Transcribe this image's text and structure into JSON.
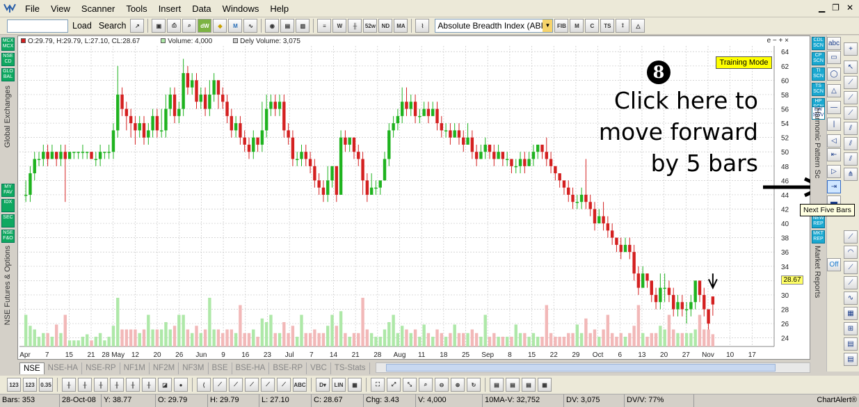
{
  "menubar": {
    "items": [
      "File",
      "View",
      "Scanner",
      "Tools",
      "Insert",
      "Data",
      "Windows",
      "Help"
    ]
  },
  "toolbar": {
    "load_label": "Load",
    "search_label": "Search",
    "indicator_value": "Absolute Breadth Index (ABI"
  },
  "chart": {
    "info": {
      "ohlc": "O:29.79, H:29.79, L:27.10, CL:28.67",
      "volume": "Volume: 4,000",
      "delivery_volume": "Dely Volume: 3,075"
    },
    "controls": "e − + ×",
    "training_mode": "Training Mode",
    "current_price": "28.67"
  },
  "annotation": {
    "step_number": "8",
    "lines": [
      "Click here to",
      "move forward",
      "by 5 bars"
    ]
  },
  "tooltip": "Next Five Bars",
  "left_panel": {
    "top_buttons": [
      "MCX MCX",
      "NSE CD",
      "GLO BAL"
    ],
    "global_label": "Global Exchanges",
    "bottom_buttons": [
      "MY FAV",
      "IDX",
      "SEC",
      "NSE F&O"
    ],
    "futures_label": "NSE Futures & Options"
  },
  "right_panel": {
    "buttons": [
      "CDL SCN",
      "CP SCN",
      "TI SCN",
      "TS SCN",
      "HP SCN",
      "EW SWV"
    ],
    "harmonic_label": "Harmonic Pattern Sc",
    "buttons2": [
      "NEW REP",
      "MKT REP"
    ],
    "reports_label": "Market Reports",
    "off_label": "Off"
  },
  "tabs": [
    "NSE",
    "NSE-HA",
    "NSE-RP",
    "NF1M",
    "NF2M",
    "NF3M",
    "BSE",
    "BSE-HA",
    "BSE-RP",
    "VBC",
    "TS-Stats"
  ],
  "status": {
    "bars": "Bars: 353",
    "date": "28-Oct-08",
    "y": "Y: 38.77",
    "open": "O: 29.79",
    "high": "H: 29.79",
    "low": "L: 27.10",
    "close": "C: 28.67",
    "chg": "Chg: 3.43",
    "volume": "V: 4,000",
    "ma_vol": "10MA-V: 32,752",
    "dv": "DV: 3,075",
    "dvv": "DV/V: 77%",
    "brand": "ChartAlert®"
  },
  "colors": {
    "up_candle": "#1fb31f",
    "down_candle": "#d42020",
    "volume_up": "#aee8a8",
    "volume_down": "#f2b8b8",
    "gridline": "#c8c8c8",
    "training_bg": "#ffff00"
  },
  "chart_data": {
    "type": "candlestick",
    "title": "",
    "x_tick_labels": [
      "Apr",
      "7",
      "15",
      "21",
      "28 May",
      "12",
      "20",
      "26",
      "Jun",
      "9",
      "16",
      "23",
      "Jul",
      "7",
      "14",
      "21",
      "28",
      "Aug",
      "11",
      "18",
      "25",
      "Sep",
      "8",
      "15",
      "22",
      "29",
      "Oct",
      "6",
      "13",
      "20",
      "27",
      "Nov",
      "10",
      "17"
    ],
    "y_ticks": [
      24,
      26,
      28,
      30,
      32,
      34,
      36,
      38,
      40,
      42,
      44,
      46,
      48,
      50,
      52,
      54,
      56,
      58,
      60,
      62,
      64
    ],
    "ylim": [
      22.8,
      64.8
    ],
    "grid": true,
    "candles": [
      {
        "o": 44,
        "c": 44,
        "h": 46,
        "l": 43
      },
      {
        "o": 44,
        "c": 47,
        "h": 48,
        "l": 43
      },
      {
        "o": 47,
        "c": 49,
        "h": 50,
        "l": 46
      },
      {
        "o": 49,
        "c": 49,
        "h": 50,
        "l": 48
      },
      {
        "o": 49,
        "c": 50,
        "h": 51,
        "l": 48
      },
      {
        "o": 50,
        "c": 49,
        "h": 51,
        "l": 48
      },
      {
        "o": 49,
        "c": 50,
        "h": 51,
        "l": 49
      },
      {
        "o": 50,
        "c": 49,
        "h": 50,
        "l": 48
      },
      {
        "o": 49,
        "c": 50,
        "h": 51,
        "l": 48
      },
      {
        "o": 50,
        "c": 49,
        "h": 51,
        "l": 43
      },
      {
        "o": 49,
        "c": 50,
        "h": 50,
        "l": 49
      },
      {
        "o": 50,
        "c": 50,
        "h": 50,
        "l": 49
      },
      {
        "o": 50,
        "c": 50,
        "h": 50,
        "l": 49
      },
      {
        "o": 50,
        "c": 50,
        "h": 51,
        "l": 49
      },
      {
        "o": 50,
        "c": 50,
        "h": 50,
        "l": 49
      },
      {
        "o": 50,
        "c": 49,
        "h": 50,
        "l": 49
      },
      {
        "o": 49,
        "c": 49,
        "h": 50,
        "l": 48
      },
      {
        "o": 49,
        "c": 50,
        "h": 51,
        "l": 48
      },
      {
        "o": 50,
        "c": 50,
        "h": 50,
        "l": 49
      },
      {
        "o": 50,
        "c": 50,
        "h": 51,
        "l": 49
      },
      {
        "o": 50,
        "c": 53,
        "h": 54,
        "l": 49
      },
      {
        "o": 53,
        "c": 58,
        "h": 62,
        "l": 52
      },
      {
        "o": 58,
        "c": 56,
        "h": 59,
        "l": 55
      },
      {
        "o": 56,
        "c": 55,
        "h": 57,
        "l": 53
      },
      {
        "o": 55,
        "c": 54,
        "h": 56,
        "l": 52
      },
      {
        "o": 54,
        "c": 53,
        "h": 55,
        "l": 51
      },
      {
        "o": 53,
        "c": 54,
        "h": 55,
        "l": 52
      },
      {
        "o": 54,
        "c": 52,
        "h": 55,
        "l": 51
      },
      {
        "o": 52,
        "c": 53,
        "h": 54,
        "l": 51
      },
      {
        "o": 53,
        "c": 55,
        "h": 56,
        "l": 52
      },
      {
        "o": 55,
        "c": 53,
        "h": 56,
        "l": 52
      },
      {
        "o": 53,
        "c": 53,
        "h": 56,
        "l": 52
      },
      {
        "o": 53,
        "c": 56,
        "h": 58,
        "l": 52
      },
      {
        "o": 56,
        "c": 58,
        "h": 59,
        "l": 55
      },
      {
        "o": 58,
        "c": 55,
        "h": 59,
        "l": 54
      },
      {
        "o": 55,
        "c": 56,
        "h": 57,
        "l": 54
      },
      {
        "o": 56,
        "c": 61,
        "h": 63,
        "l": 55
      },
      {
        "o": 61,
        "c": 59,
        "h": 62,
        "l": 58
      },
      {
        "o": 59,
        "c": 60,
        "h": 61,
        "l": 58
      },
      {
        "o": 60,
        "c": 57,
        "h": 61,
        "l": 56
      },
      {
        "o": 57,
        "c": 58,
        "h": 59,
        "l": 56
      },
      {
        "o": 58,
        "c": 56,
        "h": 59,
        "l": 55
      },
      {
        "o": 56,
        "c": 58,
        "h": 60,
        "l": 55
      },
      {
        "o": 58,
        "c": 60,
        "h": 61,
        "l": 57
      },
      {
        "o": 60,
        "c": 58,
        "h": 60,
        "l": 56
      },
      {
        "o": 58,
        "c": 57,
        "h": 59,
        "l": 56
      },
      {
        "o": 57,
        "c": 55,
        "h": 58,
        "l": 54
      },
      {
        "o": 55,
        "c": 53,
        "h": 56,
        "l": 52
      },
      {
        "o": 53,
        "c": 54,
        "h": 55,
        "l": 52
      },
      {
        "o": 54,
        "c": 52,
        "h": 55,
        "l": 51
      },
      {
        "o": 52,
        "c": 51,
        "h": 53,
        "l": 50
      },
      {
        "o": 51,
        "c": 50,
        "h": 52,
        "l": 49
      },
      {
        "o": 50,
        "c": 52,
        "h": 53,
        "l": 49
      },
      {
        "o": 52,
        "c": 51,
        "h": 52,
        "l": 50
      },
      {
        "o": 51,
        "c": 53,
        "h": 57,
        "l": 50
      },
      {
        "o": 53,
        "c": 56,
        "h": 58,
        "l": 52
      },
      {
        "o": 56,
        "c": 57,
        "h": 58,
        "l": 55
      },
      {
        "o": 57,
        "c": 56,
        "h": 58,
        "l": 55
      },
      {
        "o": 56,
        "c": 57,
        "h": 58,
        "l": 55
      },
      {
        "o": 57,
        "c": 53,
        "h": 58,
        "l": 52
      },
      {
        "o": 53,
        "c": 52,
        "h": 54,
        "l": 51
      },
      {
        "o": 52,
        "c": 49,
        "h": 53,
        "l": 48
      },
      {
        "o": 49,
        "c": 49,
        "h": 50,
        "l": 48
      },
      {
        "o": 49,
        "c": 50,
        "h": 51,
        "l": 48
      },
      {
        "o": 50,
        "c": 49,
        "h": 51,
        "l": 48
      },
      {
        "o": 49,
        "c": 48,
        "h": 50,
        "l": 47
      },
      {
        "o": 48,
        "c": 46,
        "h": 49,
        "l": 45
      },
      {
        "o": 46,
        "c": 45,
        "h": 47,
        "l": 44
      },
      {
        "o": 45,
        "c": 44,
        "h": 46,
        "l": 43
      },
      {
        "o": 44,
        "c": 46,
        "h": 48,
        "l": 43
      },
      {
        "o": 46,
        "c": 48,
        "h": 48,
        "l": 45
      },
      {
        "o": 48,
        "c": 44,
        "h": 48,
        "l": 43
      },
      {
        "o": 44,
        "c": 52,
        "h": 53,
        "l": 44
      },
      {
        "o": 52,
        "c": 51,
        "h": 53,
        "l": 50
      },
      {
        "o": 51,
        "c": 52,
        "h": 52,
        "l": 50
      },
      {
        "o": 52,
        "c": 50,
        "h": 52,
        "l": 49
      },
      {
        "o": 50,
        "c": 49,
        "h": 51,
        "l": 48
      },
      {
        "o": 49,
        "c": 46,
        "h": 50,
        "l": 44
      },
      {
        "o": 46,
        "c": 44,
        "h": 47,
        "l": 43
      },
      {
        "o": 44,
        "c": 45,
        "h": 47,
        "l": 44
      },
      {
        "o": 45,
        "c": 45,
        "h": 46,
        "l": 44
      },
      {
        "o": 45,
        "c": 46,
        "h": 46,
        "l": 44
      },
      {
        "o": 46,
        "c": 49,
        "h": 50,
        "l": 46
      },
      {
        "o": 49,
        "c": 53,
        "h": 54,
        "l": 48
      },
      {
        "o": 53,
        "c": 54,
        "h": 55,
        "l": 52
      },
      {
        "o": 54,
        "c": 55,
        "h": 56,
        "l": 53
      },
      {
        "o": 55,
        "c": 57,
        "h": 59,
        "l": 54
      },
      {
        "o": 57,
        "c": 56,
        "h": 59,
        "l": 55
      },
      {
        "o": 56,
        "c": 57,
        "h": 58,
        "l": 55
      },
      {
        "o": 57,
        "c": 55,
        "h": 58,
        "l": 54
      },
      {
        "o": 55,
        "c": 55,
        "h": 56,
        "l": 54
      },
      {
        "o": 55,
        "c": 56,
        "h": 57,
        "l": 55
      },
      {
        "o": 56,
        "c": 55,
        "h": 57,
        "l": 54
      },
      {
        "o": 55,
        "c": 56,
        "h": 57,
        "l": 55
      },
      {
        "o": 56,
        "c": 54,
        "h": 57,
        "l": 53
      },
      {
        "o": 54,
        "c": 53,
        "h": 55,
        "l": 52
      },
      {
        "o": 53,
        "c": 53,
        "h": 54,
        "l": 52
      },
      {
        "o": 53,
        "c": 52,
        "h": 54,
        "l": 51
      },
      {
        "o": 52,
        "c": 53,
        "h": 54,
        "l": 52
      },
      {
        "o": 53,
        "c": 52,
        "h": 54,
        "l": 51
      },
      {
        "o": 52,
        "c": 51,
        "h": 53,
        "l": 50
      },
      {
        "o": 51,
        "c": 52,
        "h": 54,
        "l": 51
      },
      {
        "o": 52,
        "c": 50,
        "h": 53,
        "l": 49
      },
      {
        "o": 50,
        "c": 49,
        "h": 51,
        "l": 48
      },
      {
        "o": 49,
        "c": 50,
        "h": 51,
        "l": 49
      },
      {
        "o": 50,
        "c": 51,
        "h": 52,
        "l": 49
      },
      {
        "o": 51,
        "c": 50,
        "h": 51,
        "l": 49
      },
      {
        "o": 50,
        "c": 49,
        "h": 51,
        "l": 48
      },
      {
        "o": 49,
        "c": 50,
        "h": 51,
        "l": 49
      },
      {
        "o": 50,
        "c": 49,
        "h": 50,
        "l": 48
      },
      {
        "o": 49,
        "c": 49,
        "h": 50,
        "l": 48
      },
      {
        "o": 49,
        "c": 48,
        "h": 49,
        "l": 47
      },
      {
        "o": 48,
        "c": 48,
        "h": 49,
        "l": 47
      },
      {
        "o": 48,
        "c": 49,
        "h": 50,
        "l": 47
      },
      {
        "o": 49,
        "c": 48,
        "h": 50,
        "l": 47
      },
      {
        "o": 48,
        "c": 49,
        "h": 50,
        "l": 48
      },
      {
        "o": 49,
        "c": 50,
        "h": 51,
        "l": 48
      },
      {
        "o": 50,
        "c": 51,
        "h": 51,
        "l": 49
      },
      {
        "o": 51,
        "c": 50,
        "h": 51,
        "l": 49
      },
      {
        "o": 50,
        "c": 49,
        "h": 52,
        "l": 48
      },
      {
        "o": 49,
        "c": 48,
        "h": 50,
        "l": 47
      },
      {
        "o": 48,
        "c": 47,
        "h": 48,
        "l": 46
      },
      {
        "o": 47,
        "c": 46,
        "h": 47,
        "l": 45
      },
      {
        "o": 46,
        "c": 45,
        "h": 46,
        "l": 44
      },
      {
        "o": 45,
        "c": 44,
        "h": 46,
        "l": 43
      },
      {
        "o": 44,
        "c": 43,
        "h": 45,
        "l": 42
      },
      {
        "o": 43,
        "c": 43,
        "h": 44,
        "l": 42
      },
      {
        "o": 43,
        "c": 44,
        "h": 45,
        "l": 42
      },
      {
        "o": 44,
        "c": 43,
        "h": 49,
        "l": 42
      },
      {
        "o": 43,
        "c": 42,
        "h": 44,
        "l": 41
      },
      {
        "o": 42,
        "c": 40,
        "h": 43,
        "l": 39
      },
      {
        "o": 40,
        "c": 41,
        "h": 42,
        "l": 40
      },
      {
        "o": 41,
        "c": 40,
        "h": 43,
        "l": 39
      },
      {
        "o": 40,
        "c": 39,
        "h": 41,
        "l": 38
      },
      {
        "o": 39,
        "c": 38,
        "h": 40,
        "l": 37
      },
      {
        "o": 38,
        "c": 37,
        "h": 38,
        "l": 36
      },
      {
        "o": 37,
        "c": 36,
        "h": 38,
        "l": 35
      },
      {
        "o": 36,
        "c": 37,
        "h": 38,
        "l": 36
      },
      {
        "o": 37,
        "c": 36,
        "h": 38,
        "l": 35
      },
      {
        "o": 36,
        "c": 33,
        "h": 37,
        "l": 32
      },
      {
        "o": 33,
        "c": 31,
        "h": 34,
        "l": 30
      },
      {
        "o": 31,
        "c": 33,
        "h": 34,
        "l": 31
      },
      {
        "o": 33,
        "c": 32,
        "h": 33,
        "l": 31
      },
      {
        "o": 32,
        "c": 30,
        "h": 32,
        "l": 29
      },
      {
        "o": 30,
        "c": 29,
        "h": 31,
        "l": 28
      },
      {
        "o": 29,
        "c": 31,
        "h": 33,
        "l": 28
      },
      {
        "o": 31,
        "c": 31,
        "h": 33,
        "l": 29
      },
      {
        "o": 31,
        "c": 30,
        "h": 32,
        "l": 29
      },
      {
        "o": 30,
        "c": 28,
        "h": 31,
        "l": 27
      },
      {
        "o": 28,
        "c": 29,
        "h": 30,
        "l": 27
      },
      {
        "o": 29,
        "c": 28,
        "h": 30,
        "l": 27
      },
      {
        "o": 28,
        "c": 28,
        "h": 29,
        "l": 26
      },
      {
        "o": 28,
        "c": 29,
        "h": 30,
        "l": 27
      },
      {
        "o": 29,
        "c": 32,
        "h": 32,
        "l": 28
      },
      {
        "o": 32,
        "c": 30,
        "h": 32,
        "l": 29
      },
      {
        "o": 30,
        "c": 28,
        "h": 31,
        "l": 27
      },
      {
        "o": 28,
        "c": 26,
        "h": 28,
        "l": 24
      },
      {
        "o": 29.79,
        "c": 28.67,
        "h": 29.79,
        "l": 27.1
      }
    ],
    "volume_ylim": [
      0,
      60
    ]
  }
}
